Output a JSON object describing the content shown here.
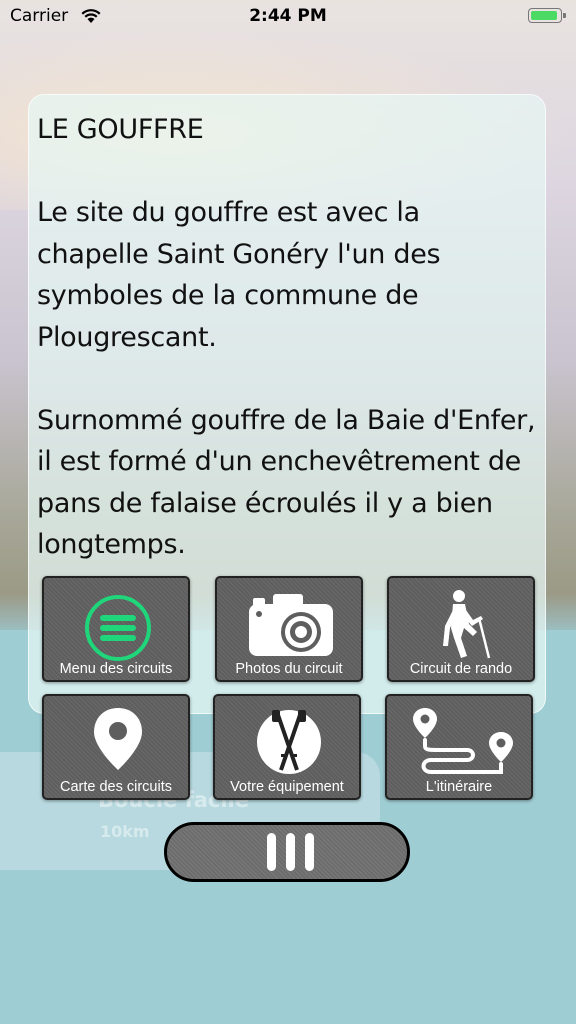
{
  "status_bar": {
    "carrier": "Carrier",
    "time": "2:44 PM"
  },
  "background": {
    "route_title": "Boucle facile",
    "route_sub": "10km"
  },
  "article": {
    "title": "LE GOUFFRE",
    "paragraph1": "Le site du gouffre est avec la chapelle Saint Gonéry l'un des symboles de la commune de Plougrescant.",
    "paragraph2": "Surnommé gouffre de la Baie d'Enfer, il est formé d'un enchevêtrement de pans de falaise écroulés il y a bien longtemps."
  },
  "menu": {
    "items": [
      {
        "label": "Menu des circuits",
        "icon": "hamburger-menu-icon"
      },
      {
        "label": "Photos du circuit",
        "icon": "camera-icon"
      },
      {
        "label": "Circuit de rando",
        "icon": "hiker-icon"
      },
      {
        "label": "Carte des circuits",
        "icon": "map-pin-icon"
      },
      {
        "label": "Votre équipement",
        "icon": "hiking-poles-icon"
      },
      {
        "label": "L'itinéraire",
        "icon": "route-icon"
      }
    ]
  },
  "colors": {
    "accent": "#1fd67a",
    "tile_bg": "#646464",
    "teal": "#9fcdd4"
  }
}
